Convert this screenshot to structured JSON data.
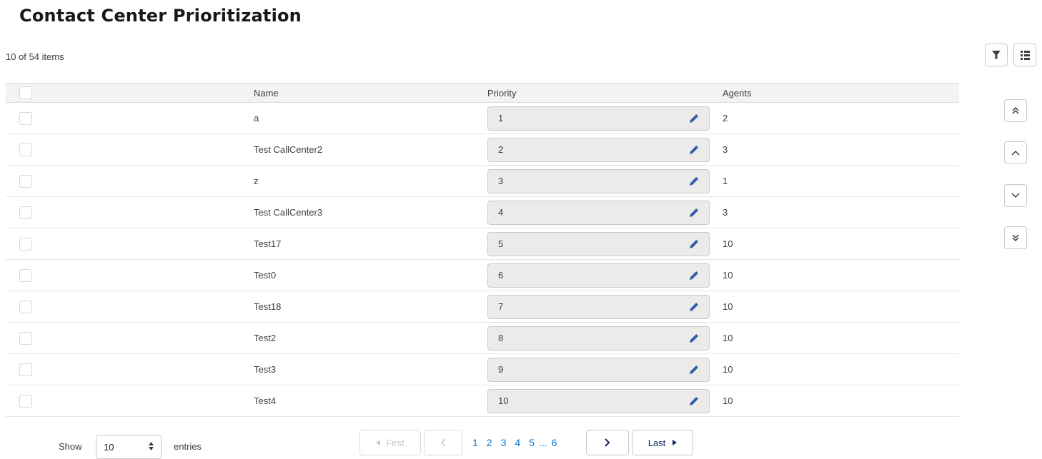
{
  "page_title": "Contact Center Prioritization",
  "item_count": "10 of 54 items",
  "icons": {
    "filter": "filter-icon",
    "columns": "columns-icon",
    "edit": "pencil-icon",
    "move_top": "double-chevron-up-icon",
    "move_up": "chevron-up-icon",
    "move_down": "chevron-down-icon",
    "move_bottom": "double-chevron-down-icon"
  },
  "colors": {
    "accent": "#0176d3",
    "edit_icon": "#2f5fa8",
    "prio_bg": "#ecebea",
    "header_bg": "#f3f3f3"
  },
  "table": {
    "columns": [
      "Name",
      "Priority",
      "Agents"
    ],
    "rows": [
      {
        "name": "a",
        "priority": "1",
        "agents": "2"
      },
      {
        "name": "Test CallCenter2",
        "priority": "2",
        "agents": "3"
      },
      {
        "name": "z",
        "priority": "3",
        "agents": "1"
      },
      {
        "name": "Test CallCenter3",
        "priority": "4",
        "agents": "3"
      },
      {
        "name": "Test17",
        "priority": "5",
        "agents": "10"
      },
      {
        "name": "Test0",
        "priority": "6",
        "agents": "10"
      },
      {
        "name": "Test18",
        "priority": "7",
        "agents": "10"
      },
      {
        "name": "Test2",
        "priority": "8",
        "agents": "10"
      },
      {
        "name": "Test3",
        "priority": "9",
        "agents": "10"
      },
      {
        "name": "Test4",
        "priority": "10",
        "agents": "10"
      }
    ]
  },
  "footer": {
    "show_label": "Show",
    "entries_value": "10",
    "entries_label": "entries",
    "first_label": "First",
    "last_label": "Last",
    "pages": [
      "1",
      "2",
      "3",
      "4",
      "5",
      "...",
      "6"
    ]
  }
}
